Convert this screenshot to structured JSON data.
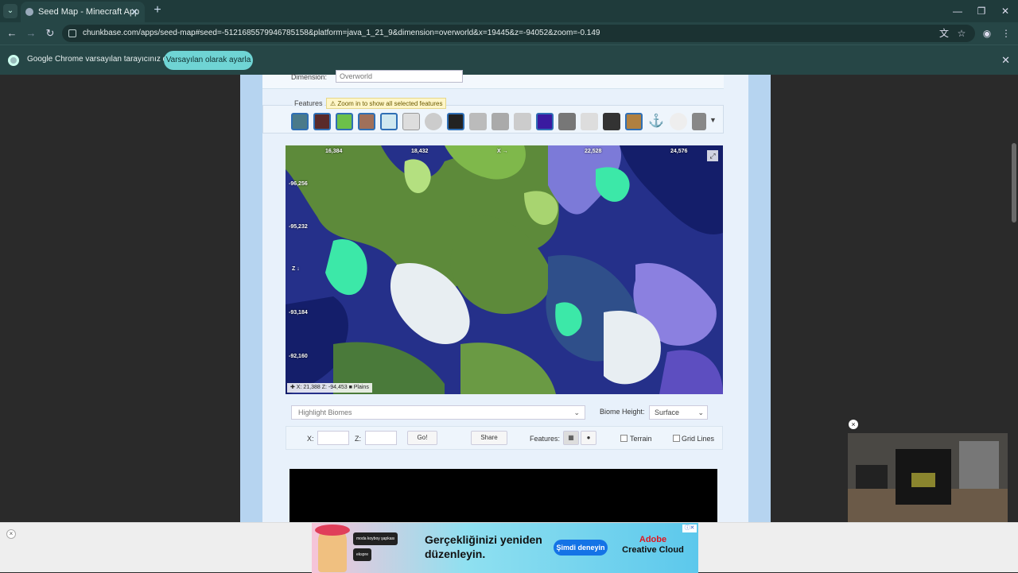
{
  "browser": {
    "tab_title": "Seed Map - Minecraft App",
    "url": "chunkbase.com/apps/seed-map#seed=-5121685579946785158&platform=java_1_21_9&dimension=overworld&x=19445&z=-94052&zoom=-0.149",
    "info_text": "Google Chrome varsayılan tarayıcınız değil",
    "info_button": "Varsayılan olarak ayarla"
  },
  "seedmap": {
    "dimension_label": "Dimension:",
    "dimension_value": "Overworld",
    "features_label": "Features",
    "zoom_warning": "⚠ Zoom in to show all selected features",
    "map": {
      "x_labels": [
        "16,384",
        "18,432",
        "X →",
        "22,528",
        "24,576"
      ],
      "z_labels": [
        "-96,256",
        "-95,232",
        "Z ↓",
        "-93,184",
        "-92,160"
      ],
      "status": "✚ X: 21,388 Z: -94,453 ■ Plains",
      "expand_icon": "⤢"
    },
    "highlight_biomes": "Highlight Biomes",
    "biome_height_label": "Biome Height:",
    "biome_height_value": "Surface",
    "x_label": "X:",
    "z_label": "Z:",
    "go_button": "Go!",
    "share_button": "Share",
    "features_toggle_label": "Features:",
    "terrain_label": "Terrain",
    "grid_lines_label": "Grid Lines"
  },
  "ad": {
    "headline": "Gerçekliğinizi yeniden düzenleyin.",
    "cta": "Şimdi deneyin",
    "brand_line1": "Adobe",
    "brand_line2": "Creative Cloud",
    "chip1": "moda koyboy şapkası",
    "chip2": "ekspre"
  }
}
